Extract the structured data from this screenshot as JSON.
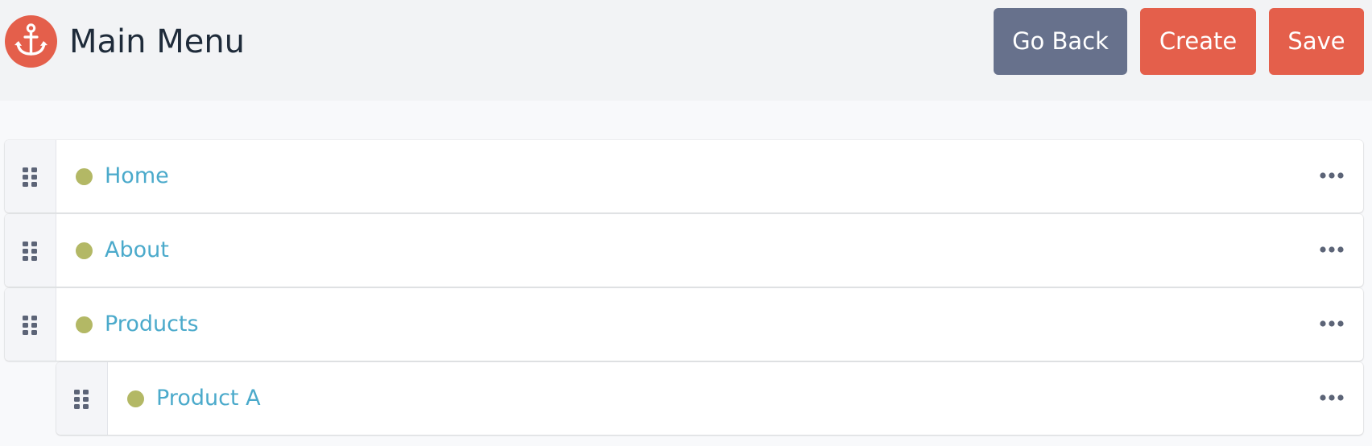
{
  "header": {
    "title": "Main Menu",
    "logo_icon": "anchor-icon",
    "brand_color": "#e45f4b"
  },
  "actions": {
    "go_back": "Go Back",
    "create": "Create",
    "save": "Save"
  },
  "menu_items": [
    {
      "label": "Home",
      "depth": 0,
      "status_color": "#b3b865"
    },
    {
      "label": "About",
      "depth": 0,
      "status_color": "#b3b865"
    },
    {
      "label": "Products",
      "depth": 0,
      "status_color": "#b3b865"
    },
    {
      "label": "Product A",
      "depth": 1,
      "status_color": "#b3b865"
    }
  ],
  "icons": {
    "drag_handle": "drag-handle-icon",
    "more": "more-options-icon"
  }
}
